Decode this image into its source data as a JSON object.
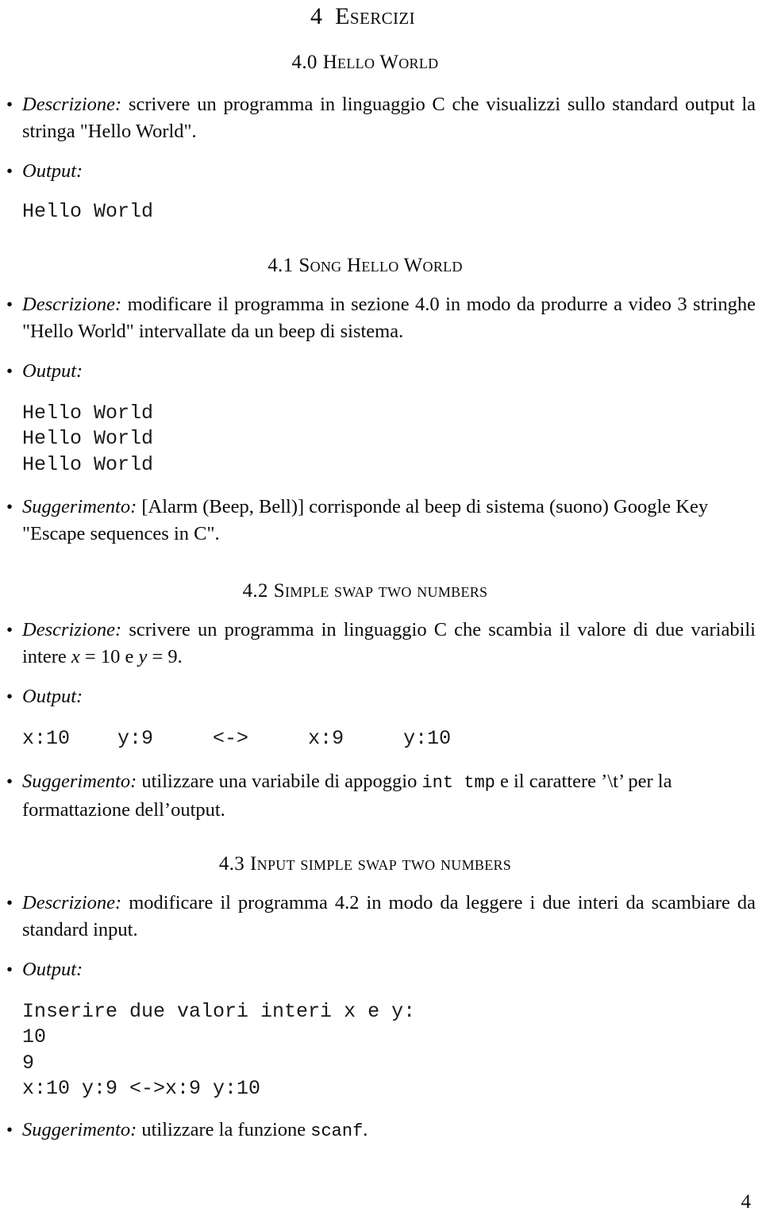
{
  "document": {
    "chapter": {
      "number": "4",
      "title": "Esercizi"
    },
    "page_number": "4",
    "bullet_glyph": "•"
  },
  "sections": [
    {
      "number": "4.0",
      "title": "Hello World",
      "items": [
        {
          "lead": "Descrizione:",
          "text": " scrivere un programma in linguaggio C che visualizzi sullo standard output la stringa \"Hello World\"."
        },
        {
          "lead": "Output:",
          "text": ""
        }
      ],
      "output": "Hello World"
    },
    {
      "number": "4.1",
      "title": "Song Hello World",
      "items": [
        {
          "lead": "Descrizione:",
          "text": " modificare il programma in sezione 4.0 in modo da produrre a video 3 stringhe \"Hello World\" intervallate da un beep di sistema."
        },
        {
          "lead": "Output:",
          "text": ""
        }
      ],
      "output": "Hello World\nHello World\nHello World",
      "hint_lead": "Suggerimento:",
      "hint_text": " [Alarm (Beep, Bell)] corrisponde al beep di sistema (suono) Google Key \"Escape sequences in C\"."
    },
    {
      "number": "4.2",
      "title": "Simple swap two numbers",
      "desc_lead": "Descrizione:",
      "desc_part1": " scrivere un programma in linguaggio C che scambia il valore di due variabili intere ",
      "desc_var_x": "x",
      "desc_eq_x": " = 10 e ",
      "desc_var_y": "y",
      "desc_eq_y": " = 9.",
      "output_lead": "Output:",
      "output": "x:10\ty:9\t<->\tx:9\ty:10",
      "hint_lead": "Suggerimento:",
      "hint_part1": " utilizzare una variabile di appoggio ",
      "hint_code": "int  tmp",
      "hint_part2": " e il carattere ’\\t’ per la formattazione dell’output."
    },
    {
      "number": "4.3",
      "title": "Input simple swap two numbers",
      "items": [
        {
          "lead": "Descrizione:",
          "text": " modificare il programma 4.2 in modo da leggere i due interi da scambiare da standard input."
        },
        {
          "lead": "Output:",
          "text": ""
        }
      ],
      "output": "Inserire due valori interi x e y:\n10\n9\nx:10 y:9 <->x:9 y:10",
      "hint_lead": "Suggerimento:",
      "hint_part1": " utilizzare la funzione ",
      "hint_code": "scanf",
      "hint_part2": "."
    }
  ]
}
